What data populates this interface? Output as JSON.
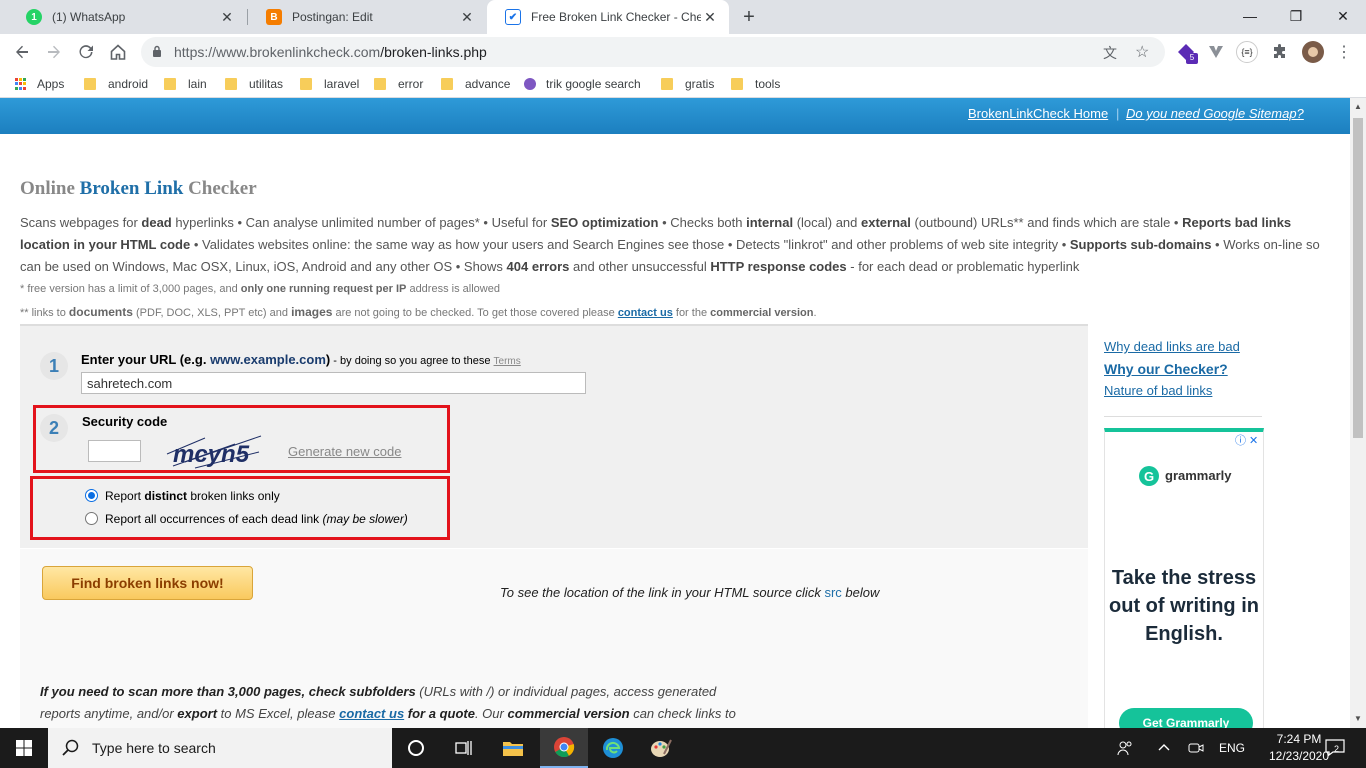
{
  "browser": {
    "tabs": [
      {
        "title": "(1) WhatsApp",
        "badge": "1",
        "color": "#25d366"
      },
      {
        "title": "Postingan: Edit",
        "badge": "B",
        "color": "#f57d00"
      },
      {
        "title": "Free Broken Link Checker - Check",
        "badge": "✔",
        "color": "#1a73e8"
      }
    ],
    "new_tab": "+",
    "url_host": "https://www.brokenlinkcheck.com",
    "url_path": "/broken-links.php",
    "extension_badge": "5",
    "window_controls": {
      "minimize": "—",
      "maximize": "❐",
      "close": "✕"
    }
  },
  "bookmarks": [
    {
      "label": "Apps",
      "kind": "apps"
    },
    {
      "label": "android",
      "kind": "folder"
    },
    {
      "label": "lain",
      "kind": "folder"
    },
    {
      "label": "utilitas",
      "kind": "folder"
    },
    {
      "label": "laravel",
      "kind": "folder"
    },
    {
      "label": "error",
      "kind": "folder"
    },
    {
      "label": "advance",
      "kind": "folder"
    },
    {
      "label": "trik google search",
      "kind": "site"
    },
    {
      "label": "gratis",
      "kind": "folder"
    },
    {
      "label": "tools",
      "kind": "folder"
    }
  ],
  "page": {
    "banner_links": {
      "home": "BrokenLinkCheck Home",
      "separator": "|",
      "sitemap": "Do you need Google Sitemap?"
    },
    "title": {
      "part1": "Online ",
      "part2": "Broken Link",
      "part3": " Checker"
    },
    "description": {
      "s1": "Scans webpages for ",
      "b1": "dead",
      "s2": " hyperlinks • Can analyse unlimited number of pages* • Useful for ",
      "b2": "SEO optimization",
      "s3": " • Checks both ",
      "b3": "internal",
      "s4": " (local) and ",
      "b4": "external",
      "s5": " (outbound) URLs** and finds which are stale • ",
      "b5": "Reports bad links location in your HTML code",
      "s6": " • Validates websites online: the same way as how your users and Search Engines see those • Detects \"linkrot\" and other problems of web site integrity • ",
      "b6": "Supports sub-domains",
      "s7": " • Works on-line so can be used on Windows, Mac OSX, Linux, iOS, Android and any other OS • Shows ",
      "b7": "404 errors",
      "s8": " and other unsuccessful ",
      "b8": "HTTP response codes",
      "s9": " - for each dead or problematic hyperlink"
    },
    "note1": {
      "pre": "*  free version has a limit of 3,000 pages, and ",
      "bold": "only one running request per IP",
      "post": " address is allowed"
    },
    "note2": {
      "pre": "** links to ",
      "b1": "documents",
      "mid1": " (PDF, DOC, XLS, PPT etc) and ",
      "b2": "images",
      "mid2": " are not going to be checked. To get those covered please ",
      "link": "contact us",
      "mid3": " for the ",
      "b3": "commercial version",
      "end": "."
    },
    "form": {
      "step1_num": "1",
      "step1_label": "Enter your URL (e.g. ",
      "step1_example": "www.example.com",
      "step1_close": ")",
      "step1_agree": " - by doing so you agree to these ",
      "terms": "Terms",
      "url_value": "sahretech.com",
      "step2_num": "2",
      "security_label": "Security code",
      "captcha_text": "mcyn5",
      "generate": "Generate new code",
      "radio1_pre": "Report ",
      "radio1_bold": "distinct",
      "radio1_post": " broken links only",
      "radio2_pre": "Report all occurrences of each dead link ",
      "radio2_italic": "(may be slower)"
    },
    "find_button": "Find broken links now!",
    "src_hint": {
      "pre": "To see the location of the link in your HTML source click ",
      "src": "src",
      "post": " below"
    },
    "promo": {
      "b1": "If you need to scan more than 3,000 pages, check subfolders",
      "s1": " (URLs with /) or individual pages, access generated reports anytime, and/or ",
      "b2": "export",
      "s2": " to MS Excel, please ",
      "link": "contact us",
      "b3": " for a quote",
      "s3": ". Our ",
      "b4": "commercial version",
      "s4": " can check links to"
    },
    "sidebar": {
      "link1": "Why dead links are bad",
      "link2": "Why our Checker?",
      "link3": "Nature of bad links"
    },
    "ad": {
      "brand": "grammarly",
      "logo_letter": "G",
      "headline": "Take the stress out of writing in English.",
      "cta": "Get Grammarly",
      "icons": "ⓘ ✕"
    }
  },
  "taskbar": {
    "search_placeholder": "Type here to search",
    "language": "ENG",
    "time": "7:24 PM",
    "date": "12/23/2020",
    "notification_count": "2"
  },
  "colors": {
    "accent_blue": "#1f6fa8",
    "highlight_red": "#e3131b",
    "grammarly_green": "#15c39a",
    "button_gold": "#f9c95e"
  }
}
